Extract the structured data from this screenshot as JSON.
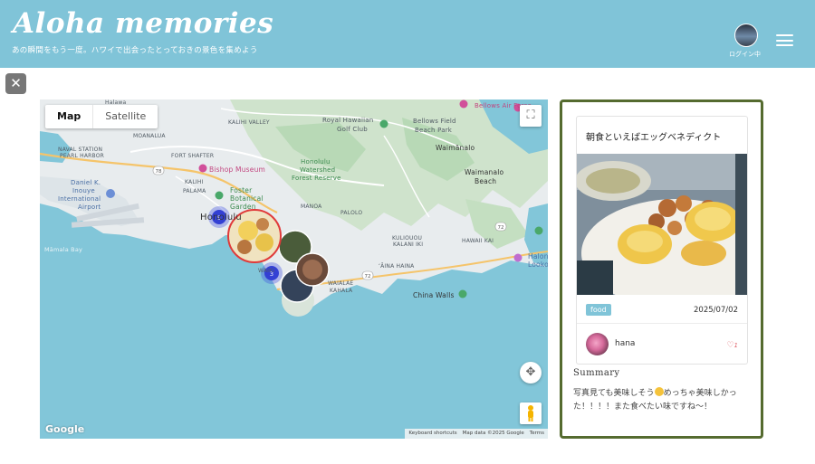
{
  "header": {
    "title": "Aloha memories",
    "tagline": "あの瞬間をもう一度。ハワイで出会ったとっておきの景色を集めよう",
    "login_label": "ログイン中",
    "bg_color": "#80c4d8"
  },
  "close_button": {
    "label": "✕"
  },
  "map": {
    "type_options": [
      "Map",
      "Satellite"
    ],
    "selected_type": "Map",
    "place_labels": {
      "halawa": "Halawa",
      "moanalua": "MOANALUA",
      "kalihi_valley": "KALIHI VALLEY",
      "royal_hawaiian": "Royal Hawaiian",
      "golf_club": "Golf Club",
      "bellows_air_force": "Bellows Air Force",
      "bellows_field": "Bellows Field",
      "beach_park": "Beach Park",
      "naval_station": "NAVAL STATION",
      "pearl_harbor": "PEARL HARBOR",
      "fort_shafter": "FORT SHAFTER",
      "waimanalo": "Waimānalo",
      "bishop_museum": "Bishop Museum",
      "honolulu_watershed": "Honolulu",
      "watershed": "Watershed",
      "forest_reserve": "Forest Reserve",
      "waimanalo_beach_1": "Waimanalo",
      "waimanalo_beach_2": "Beach",
      "daniel_1": "Daniel K.",
      "daniel_2": "Inouye",
      "daniel_3": "International",
      "daniel_4": "Airport",
      "kalihi": "KALIHI",
      "palama": "PALAMA",
      "foster_1": "Foster",
      "foster_2": "Botanical",
      "foster_3": "Garden",
      "honolulu": "Honolulu",
      "manoa": "MANOA",
      "palolo": "PALOLO",
      "kuliouou_1": "KULIOUOU",
      "kuliouou_2": "KALANI IKI",
      "hawaii_kai": "HAWAII KAI",
      "mamala_bay": "Māmala Bay",
      "waikiki": "WAIKI",
      "aina_haina": "ʻĀINA HAINA",
      "waialae": "WAIALAE",
      "kahala": "KAHALA",
      "china_walls": "China Walls",
      "halona_1": "Halon",
      "halona_2": "Looko"
    },
    "route_numbers": [
      "78",
      "72",
      "72"
    ],
    "clusters": [
      {
        "count": "5"
      },
      {
        "count": "3"
      }
    ],
    "google_logo": "Google",
    "attribution": [
      "Keyboard shortcuts",
      "Map data ©2025 Google",
      "Terms"
    ]
  },
  "post_card": {
    "title": "朝食といえばエッグベネディクト",
    "tag": "food",
    "date": "2025/07/02",
    "username": "hana",
    "likes": "1",
    "summary_heading": "Summary",
    "summary_text_1": "写真見ても美味しそう",
    "summary_text_2": "めっちゃ美味しかった！！！！また食べたい味ですね〜！",
    "border_color": "#556b2f"
  },
  "icons": {
    "fullscreen": "fullscreen-icon",
    "pan": "camera-control-icon",
    "pegman": "pegman-icon",
    "heart": "heart-icon",
    "menu": "hamburger-menu-icon"
  }
}
